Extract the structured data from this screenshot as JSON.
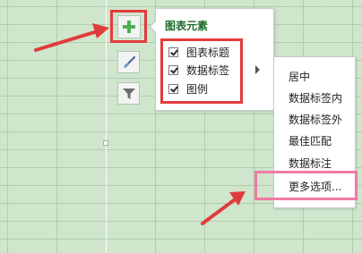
{
  "panel": {
    "title": "图表元素",
    "items": [
      {
        "label": "图表标题",
        "checked": true
      },
      {
        "label": "数据标签",
        "checked": true
      },
      {
        "label": "图例",
        "checked": true
      }
    ]
  },
  "submenu": {
    "items": [
      {
        "label": "居中"
      },
      {
        "label": "数据标签内"
      },
      {
        "label": "数据标签外"
      },
      {
        "label": "最佳匹配"
      },
      {
        "label": "数据标注"
      },
      {
        "label": "更多选项..."
      }
    ]
  },
  "sidebar": {
    "buttons": [
      {
        "icon": "plus-icon"
      },
      {
        "icon": "brush-icon"
      },
      {
        "icon": "filter-icon"
      }
    ]
  },
  "colors": {
    "highlight_red": "#e23b3b",
    "highlight_pink": "#f07aa6",
    "accent_green": "#4caf50"
  }
}
